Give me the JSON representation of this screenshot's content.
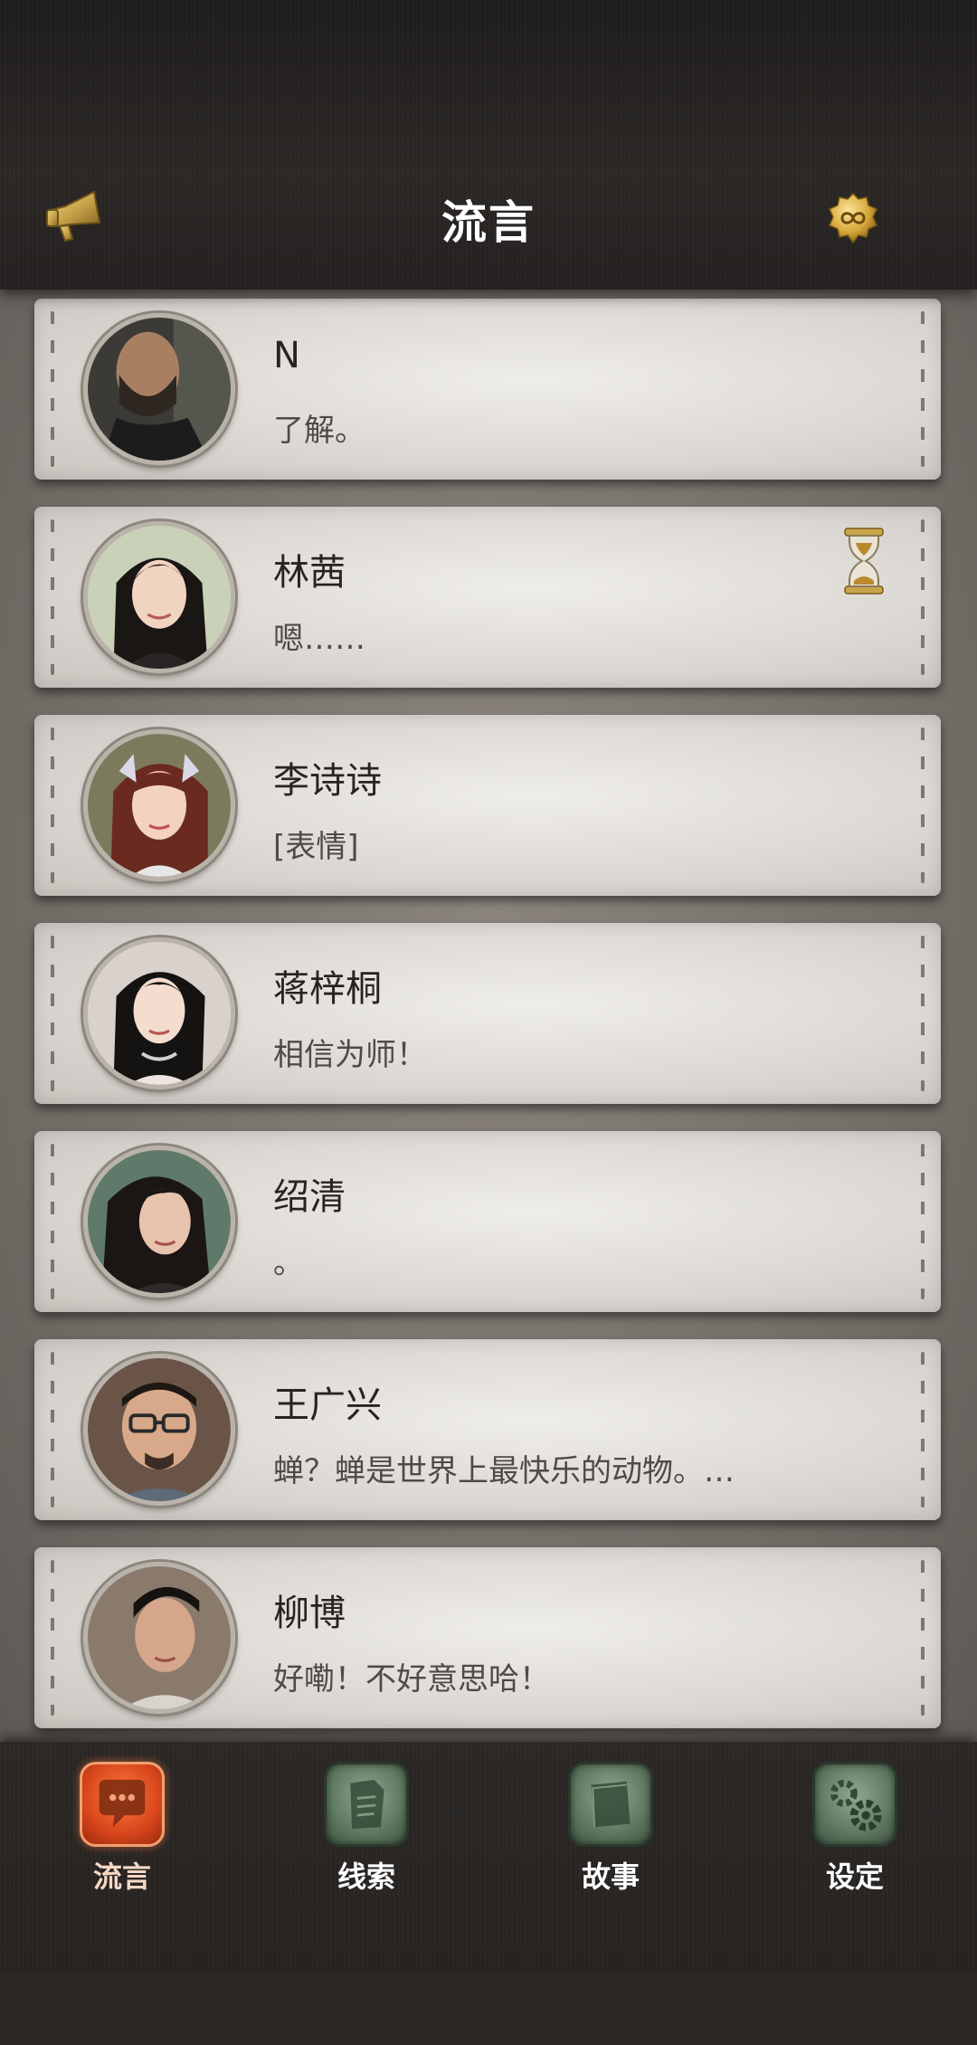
{
  "header": {
    "title": "流言",
    "left_icon": "megaphone-icon",
    "right_icon": "infinity-badge-icon",
    "accent_gold": "#c9a54a"
  },
  "contacts": [
    {
      "name": "N",
      "message": "了解。",
      "avatar": "man-dark-shirt",
      "pending": false
    },
    {
      "name": "林茜",
      "message": "嗯……",
      "avatar": "woman-long-black-hair",
      "pending": true
    },
    {
      "name": "李诗诗",
      "message": "[表情]",
      "avatar": "woman-auburn-hair",
      "pending": false
    },
    {
      "name": "蒋梓桐",
      "message": "相信为师！",
      "avatar": "woman-black-hair-necklace",
      "pending": false
    },
    {
      "name": "绍清",
      "message": "。",
      "avatar": "woman-dark-hair",
      "pending": false
    },
    {
      "name": "王广兴",
      "message": "蝉？蝉是世界上最快乐的动物。…",
      "avatar": "man-glasses",
      "pending": false
    },
    {
      "name": "柳博",
      "message": "好嘞！不好意思哈！",
      "avatar": "man-short-hair",
      "pending": false
    }
  ],
  "nav": {
    "items": [
      {
        "label": "流言",
        "icon": "chat-bubble-icon",
        "active": true
      },
      {
        "label": "线索",
        "icon": "document-icon",
        "active": false
      },
      {
        "label": "故事",
        "icon": "book-icon",
        "active": false
      },
      {
        "label": "设定",
        "icon": "gears-icon",
        "active": false
      }
    ],
    "active_color": "#e0562a",
    "inactive_color": "#5e775f"
  }
}
